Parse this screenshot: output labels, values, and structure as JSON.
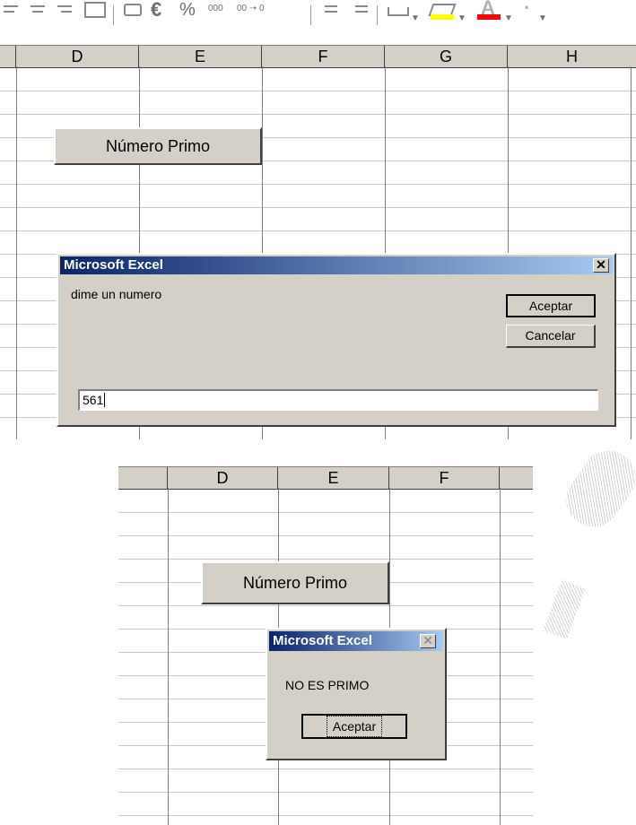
{
  "sheet1": {
    "columns": [
      "D",
      "E",
      "F",
      "G",
      "H"
    ],
    "button_label": "Número Primo"
  },
  "input_dialog": {
    "title": "Microsoft Excel",
    "close_glyph": "✕",
    "prompt": "dime un numero",
    "ok_label": "Aceptar",
    "cancel_label": "Cancelar",
    "input_value": "561"
  },
  "sheet2": {
    "columns": [
      "D",
      "E",
      "F"
    ],
    "button_label": "Número Primo"
  },
  "msg_dialog": {
    "title": "Microsoft Excel",
    "close_glyph": "✕",
    "message": "NO ES PRIMO",
    "ok_label": "Aceptar"
  },
  "toolbar": {
    "icons": [
      "align-left-icon",
      "align-center-icon",
      "align-right-icon",
      "merge-center-icon",
      "currency-icon",
      "euro-icon",
      "percent-icon",
      "thousands-icon",
      "decimal-icon",
      "indent-decrease-icon",
      "indent-increase-icon",
      "borders-icon",
      "fill-color-icon",
      "font-color-icon"
    ],
    "accent_fill": "#ffff00",
    "accent_font": "#ff0000",
    "euro_glyph": "€",
    "percent_glyph": "%",
    "thousands_label": "000",
    "decimal_label": "00 ➝ 0",
    "font_color_glyph": "A"
  }
}
